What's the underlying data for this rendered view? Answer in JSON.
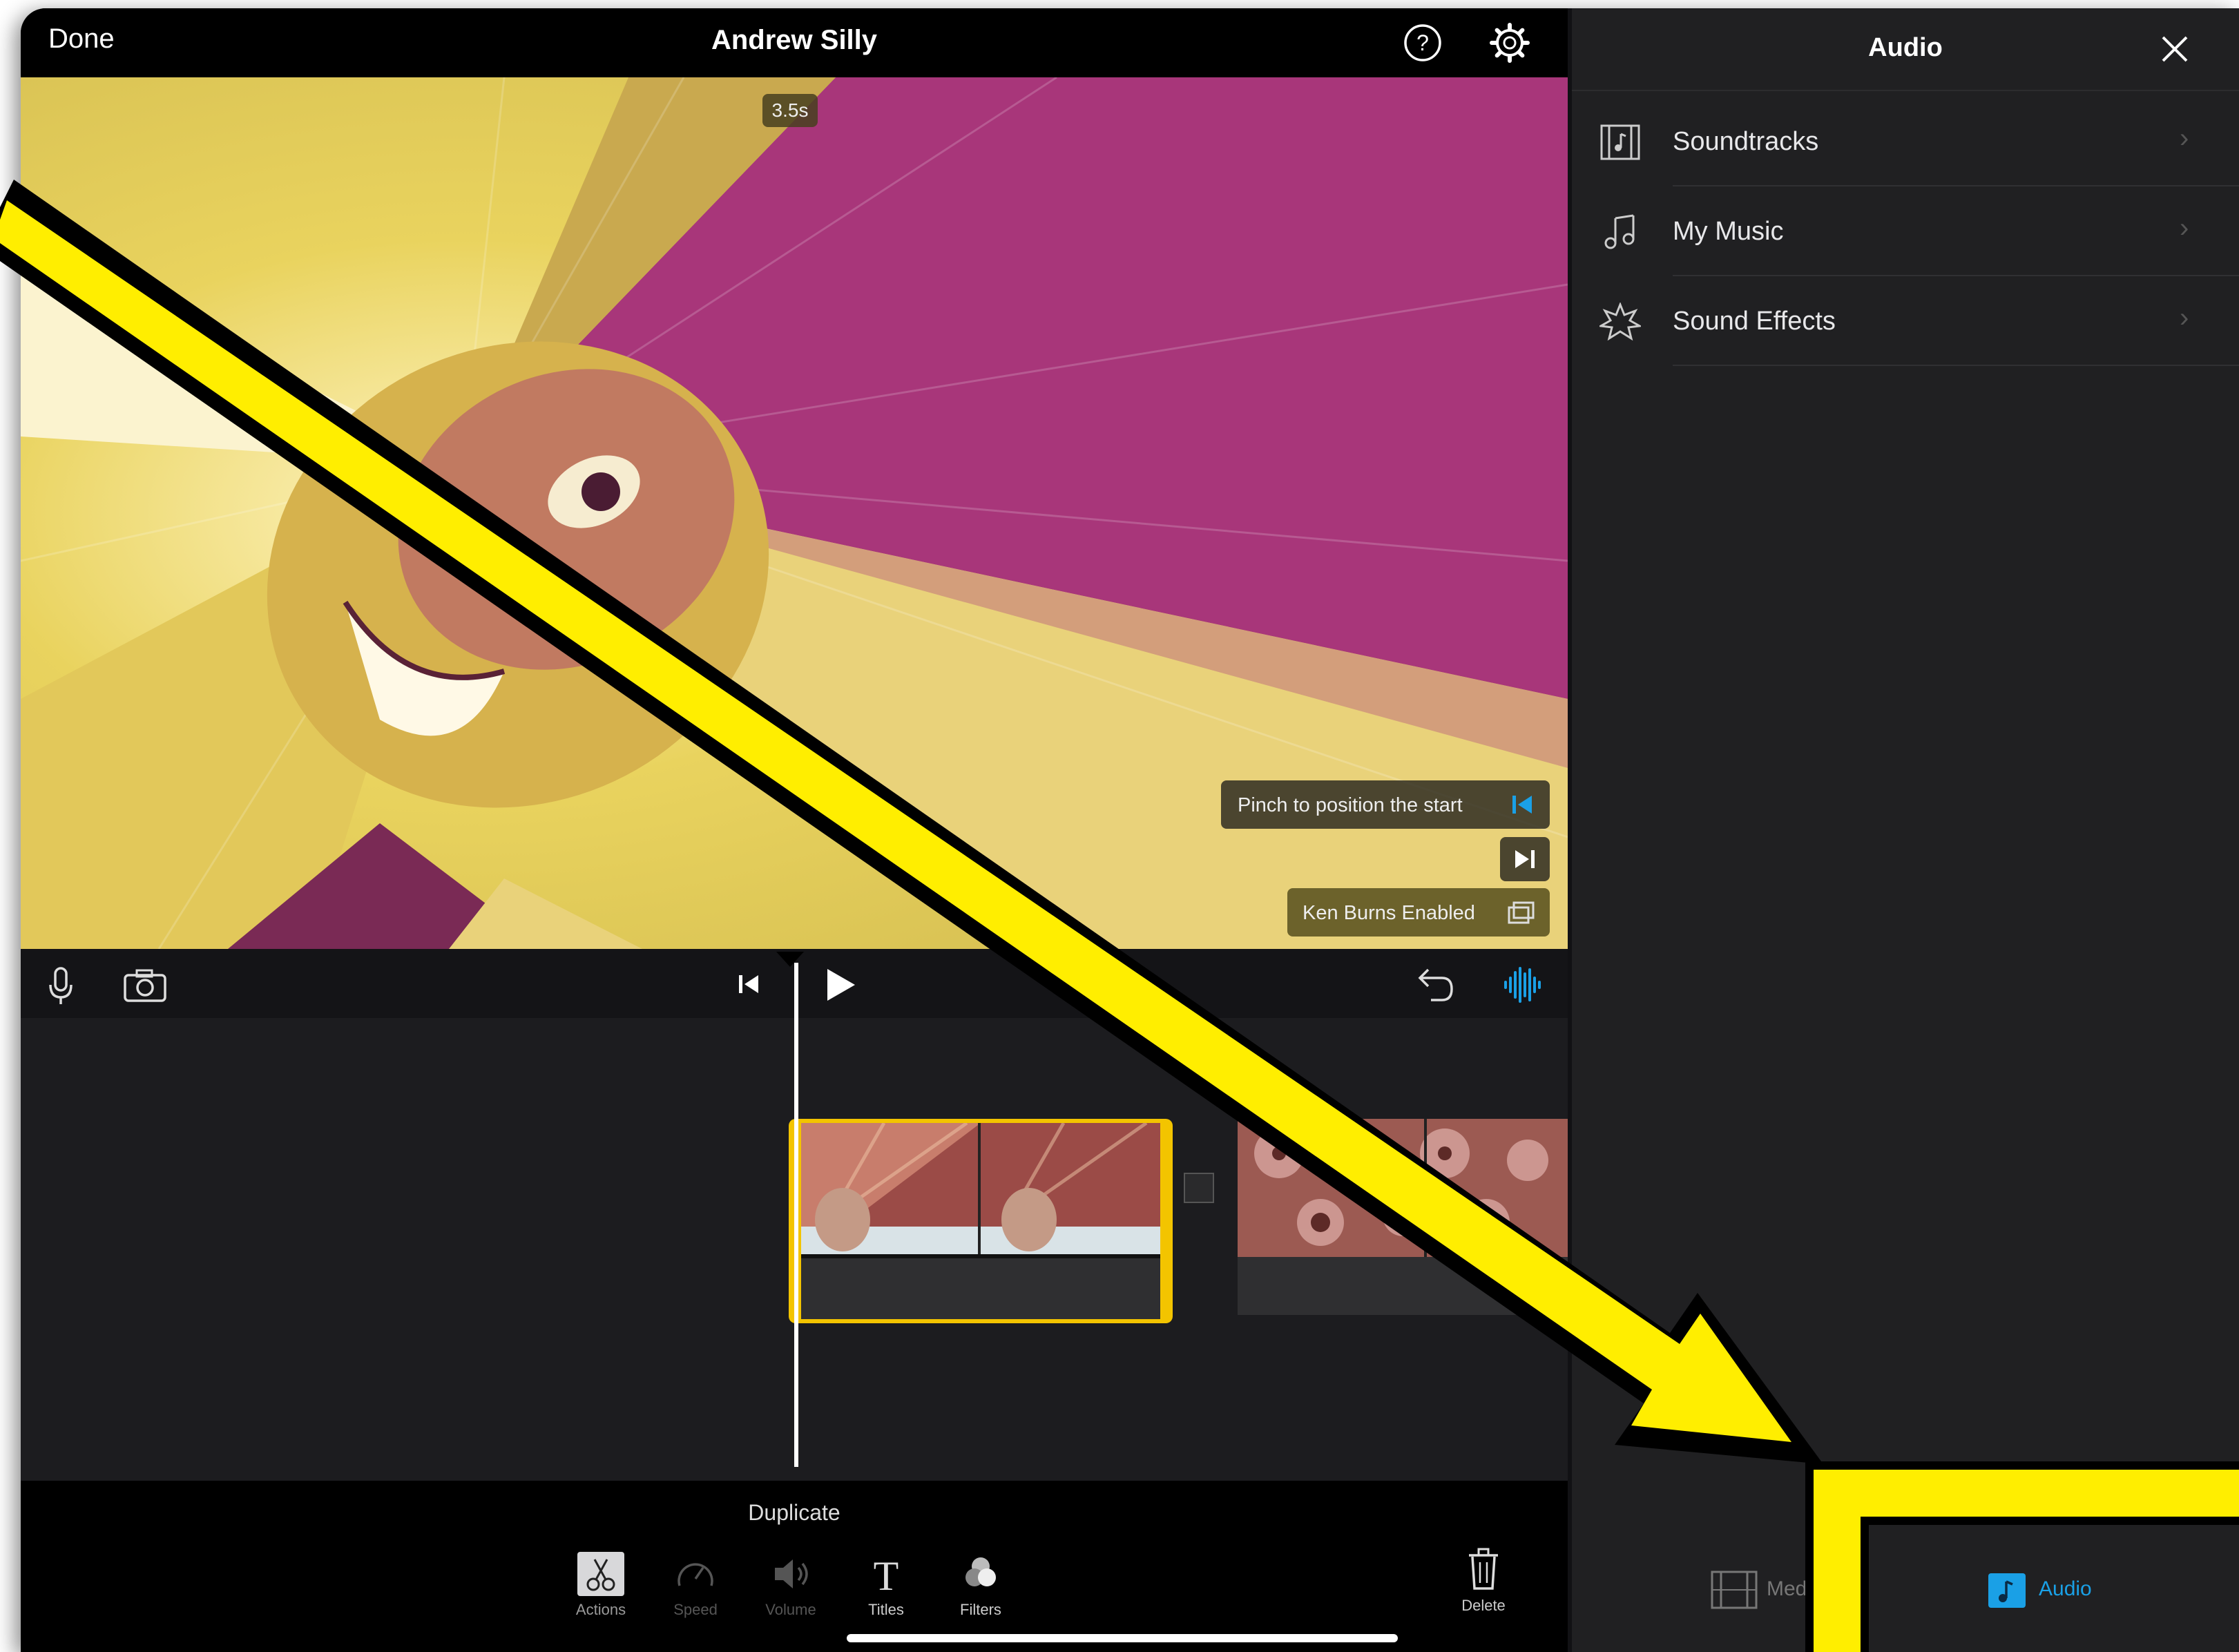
{
  "top_bar": {
    "done_label": "Done",
    "project_title": "Andrew Silly"
  },
  "viewer": {
    "duration_badge": "3.5s",
    "pinch_hint": "Pinch to position the start",
    "ken_burns_label": "Ken Burns Enabled"
  },
  "bottom_toolbar": {
    "action_title": "Duplicate",
    "tools": [
      {
        "label": "Actions",
        "icon": "scissors-icon",
        "active": true
      },
      {
        "label": "Speed",
        "icon": "speedometer-icon",
        "active": false
      },
      {
        "label": "Volume",
        "icon": "speaker-icon",
        "active": false
      },
      {
        "label": "Titles",
        "icon": "titles-icon",
        "active": true
      },
      {
        "label": "Filters",
        "icon": "filters-icon",
        "active": true
      }
    ],
    "delete_label": "Delete"
  },
  "audio_panel": {
    "title": "Audio",
    "items": [
      {
        "label": "Soundtracks",
        "icon": "soundtracks-icon"
      },
      {
        "label": "My Music",
        "icon": "music-note-icon"
      },
      {
        "label": "Sound Effects",
        "icon": "sound-effects-icon"
      }
    ]
  },
  "panel_tabs": {
    "media_label": "Media",
    "audio_label": "Audio"
  },
  "colors": {
    "accent_blue": "#1aa0e6",
    "clip_selection_yellow": "#f3c400",
    "annotation_yellow": "#ffee00",
    "viewer_yellow": "#e8cf4e",
    "viewer_magenta": "#a8367a"
  }
}
